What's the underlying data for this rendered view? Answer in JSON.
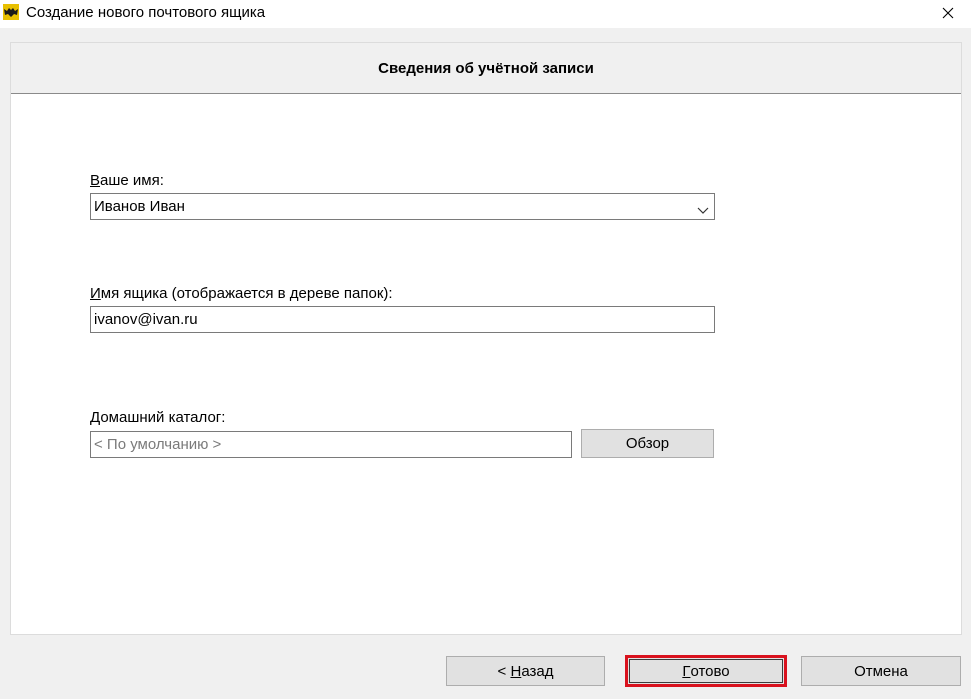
{
  "window": {
    "title": "Создание нового почтового ящика",
    "app_icon": "bat-icon"
  },
  "header": {
    "title": "Сведения об учётной записи"
  },
  "form": {
    "name": {
      "label_accel": "В",
      "label_rest": "аше имя:",
      "value": "Иванов Иван"
    },
    "mailbox": {
      "label_accel": "И",
      "label_rest": "мя ящика (отображается в дереве папок):",
      "value": "ivanov@ivan.ru"
    },
    "home_dir": {
      "label_accel": "Д",
      "label_rest": "омашний каталог:",
      "placeholder": "< По умолчанию >",
      "browse_label": "Обзор"
    }
  },
  "footer": {
    "back_prefix": "< ",
    "back_accel": "Н",
    "back_rest": "азад",
    "finish_accel": "Г",
    "finish_rest": "отово",
    "cancel_label": "Отмена"
  },
  "colors": {
    "highlight": "#d9121e",
    "window_bg": "#f0f0f0",
    "content_bg": "#ffffff"
  }
}
